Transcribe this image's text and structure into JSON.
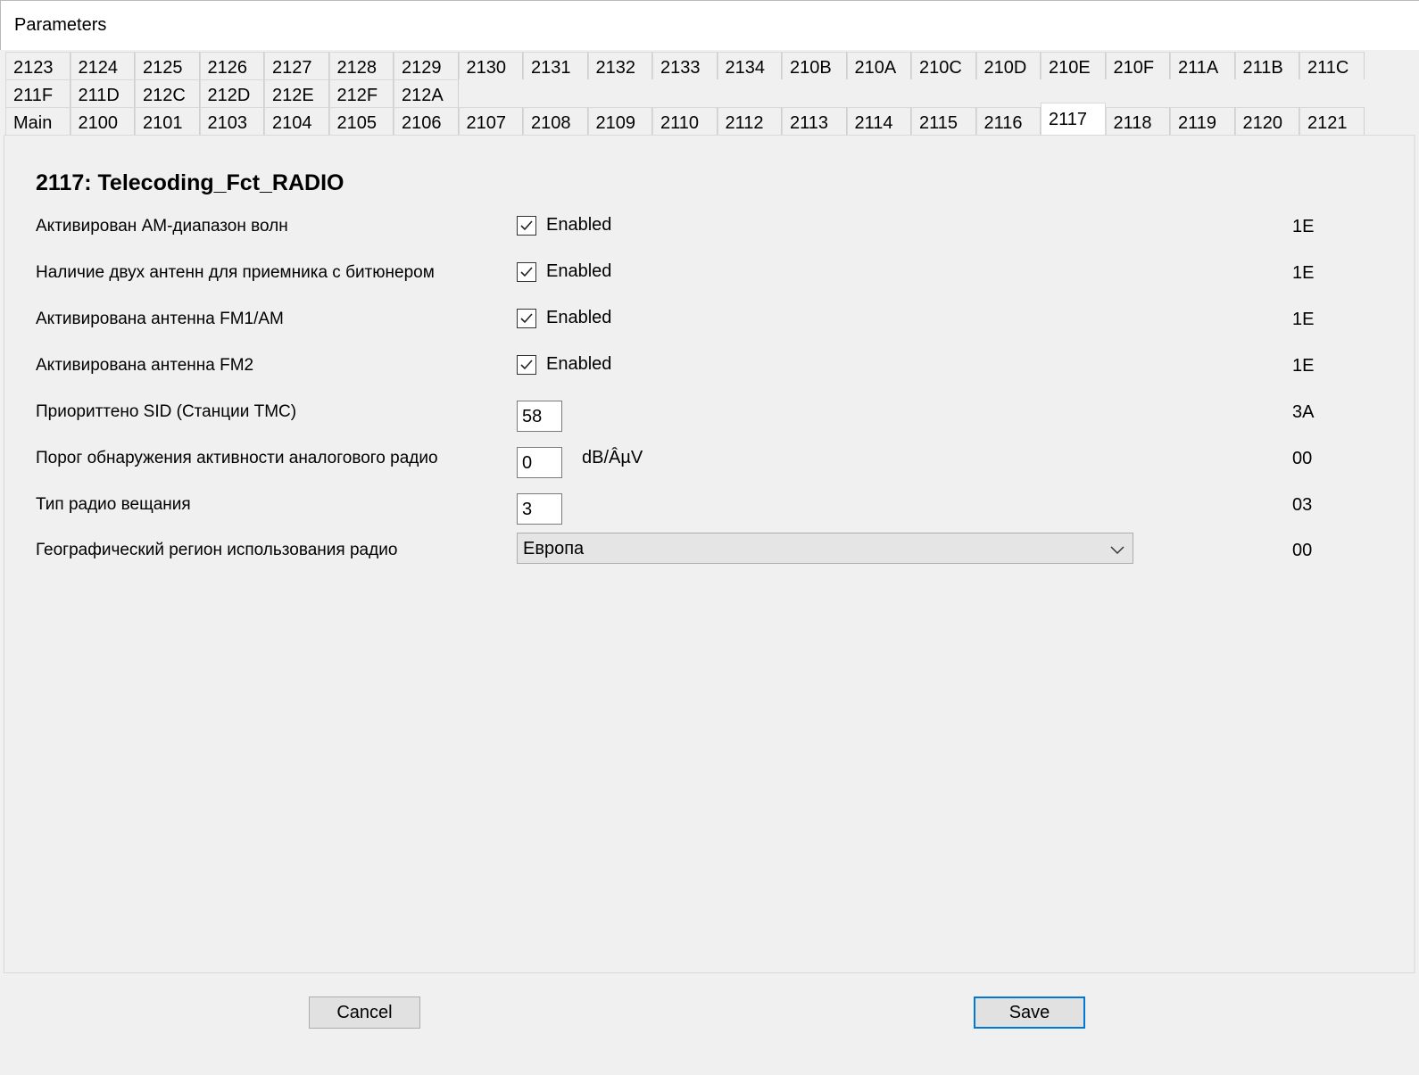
{
  "window": {
    "title": "Parameters"
  },
  "tabs": {
    "row1": [
      "2123",
      "2124",
      "2125",
      "2126",
      "2127",
      "2128",
      "2129",
      "2130",
      "2131",
      "2132",
      "2133",
      "2134",
      "210B",
      "210A",
      "210C",
      "210D",
      "210E",
      "210F",
      "211A",
      "211B",
      "211C"
    ],
    "row2": [
      "211F",
      "211D",
      "212C",
      "212D",
      "212E",
      "212F",
      "212A"
    ],
    "row3": [
      "Main",
      "2100",
      "2101",
      "2103",
      "2104",
      "2105",
      "2106",
      "2107",
      "2108",
      "2109",
      "2110",
      "2112",
      "2113",
      "2114",
      "2115",
      "2116",
      "2117",
      "2118",
      "2119",
      "2120",
      "2121"
    ],
    "active": "2117"
  },
  "panel": {
    "heading": "2117: Telecoding_Fct_RADIO",
    "rows": [
      {
        "label": "Активирован AM-диапазон волн",
        "control": "checkbox",
        "checked": true,
        "value": "Enabled",
        "code": "1E"
      },
      {
        "label": "Наличие двух антенн для приемника с битюнером",
        "control": "checkbox",
        "checked": true,
        "value": "Enabled",
        "code": "1E"
      },
      {
        "label": "Активирована антенна FM1/AM",
        "control": "checkbox",
        "checked": true,
        "value": "Enabled",
        "code": "1E"
      },
      {
        "label": "Активирована антенна FM2",
        "control": "checkbox",
        "checked": true,
        "value": "Enabled",
        "code": "1E"
      },
      {
        "label": "Приориттено SID (Станции TMC)",
        "control": "text",
        "value": "58",
        "code": "3A"
      },
      {
        "label": "Порог обнаружения активности аналогового радио",
        "control": "text",
        "value": "0",
        "unit": "dB/ÂµV",
        "code": "00"
      },
      {
        "label": "Тип радио вещания",
        "control": "text",
        "value": "3",
        "code": "03"
      },
      {
        "label": "Географический регион использования радио",
        "control": "select",
        "value": "Европа",
        "code": "00"
      }
    ]
  },
  "buttons": {
    "cancel": "Cancel",
    "save": "Save"
  },
  "colors": {
    "accent": "#0078d7",
    "window_bg": "#f0f0f0"
  }
}
